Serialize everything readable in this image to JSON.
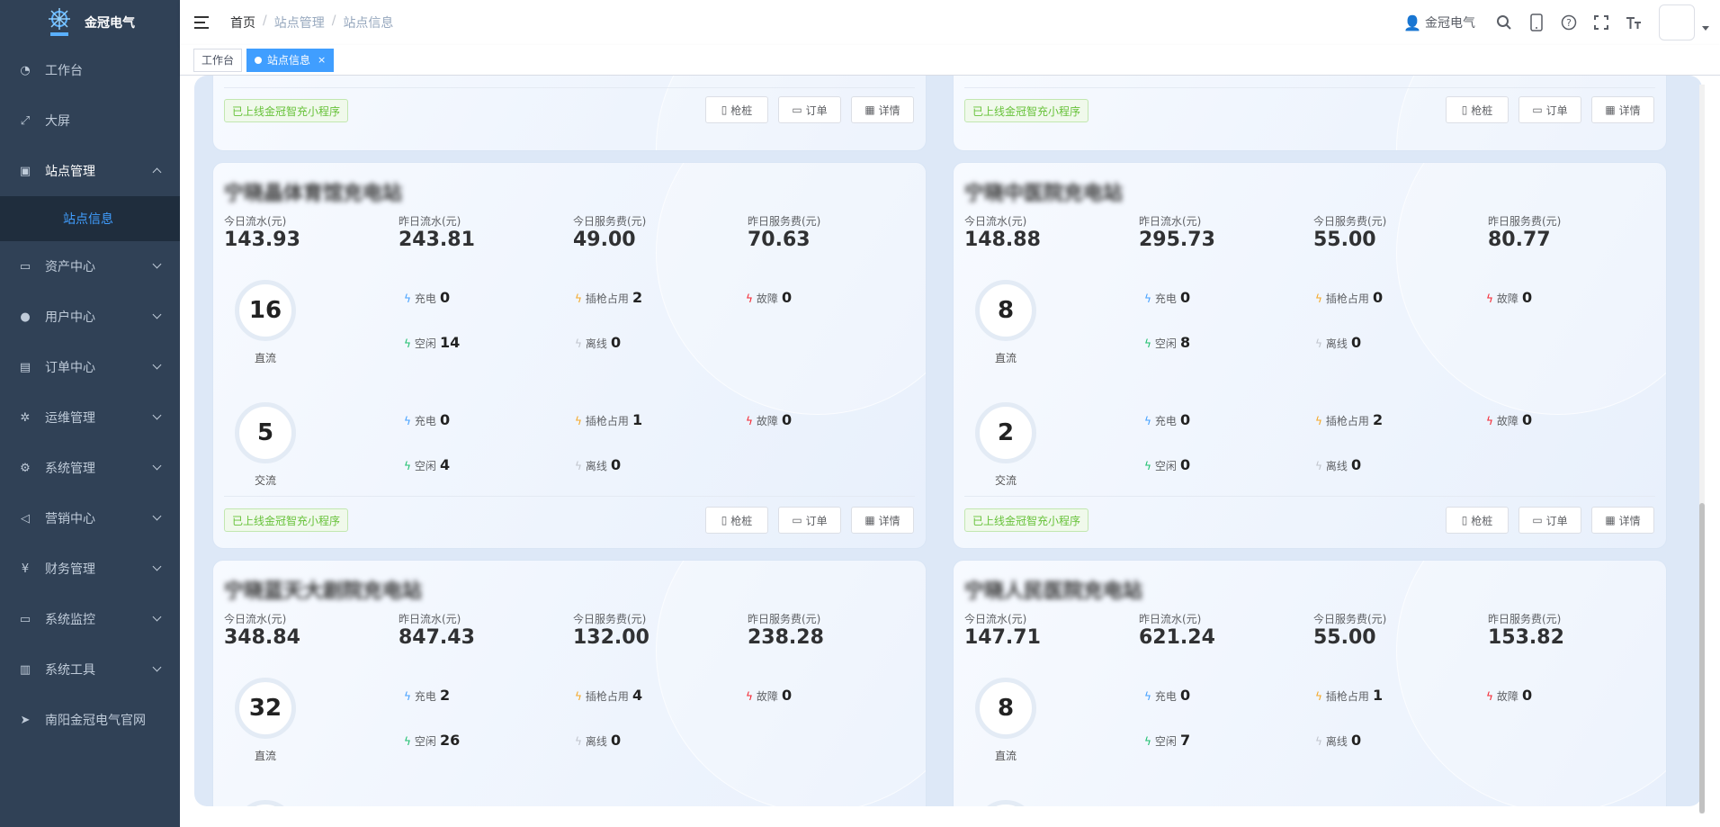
{
  "app": {
    "logo_text": "金冠电气"
  },
  "sidebar": {
    "items": [
      {
        "label": "工作台",
        "icon": "dashboard-icon",
        "expanded": false,
        "has_arrow": false
      },
      {
        "label": "大屏",
        "icon": "fullscreen-icon",
        "expanded": false,
        "has_arrow": false
      },
      {
        "label": "站点管理",
        "icon": "station-icon",
        "expanded": true,
        "has_arrow": true
      },
      {
        "label": "资产中心",
        "icon": "monitor-icon",
        "expanded": false,
        "has_arrow": true
      },
      {
        "label": "用户中心",
        "icon": "user-icon",
        "expanded": false,
        "has_arrow": true
      },
      {
        "label": "订单中心",
        "icon": "order-icon",
        "expanded": false,
        "has_arrow": true
      },
      {
        "label": "运维管理",
        "icon": "tool-icon",
        "expanded": false,
        "has_arrow": true
      },
      {
        "label": "系统管理",
        "icon": "gear-icon",
        "expanded": false,
        "has_arrow": true
      },
      {
        "label": "营销中心",
        "icon": "speaker-icon",
        "expanded": false,
        "has_arrow": true
      },
      {
        "label": "财务管理",
        "icon": "yen-icon",
        "expanded": false,
        "has_arrow": true
      },
      {
        "label": "系统监控",
        "icon": "monitor-chart-icon",
        "expanded": false,
        "has_arrow": true
      },
      {
        "label": "系统工具",
        "icon": "toolbox-icon",
        "expanded": false,
        "has_arrow": true
      },
      {
        "label": "南阳金冠电气官网",
        "icon": "send-icon",
        "expanded": false,
        "has_arrow": false
      }
    ],
    "sub_item": "站点信息"
  },
  "navbar": {
    "breadcrumb": [
      "首页",
      "站点管理",
      "站点信息"
    ],
    "separator": "/",
    "user_name": "金冠电气"
  },
  "tags": {
    "items": [
      "工作台",
      "站点信息"
    ],
    "close": "×"
  },
  "card_common": {
    "labels": {
      "today_flow": "今日流水(元)",
      "yest_flow": "昨日流水(元)",
      "today_service": "今日服务费(元)",
      "yest_service": "昨日服务费(元)",
      "charging": "充电",
      "occupied": "插枪占用",
      "fault": "故障",
      "idle": "空闲",
      "offline": "离线",
      "dc": "直流",
      "ac": "交流"
    },
    "online_text": "已上线金冠智充小程序",
    "btn_pile": "枪桩",
    "btn_order": "订单",
    "btn_detail": "详情"
  },
  "cards": [
    {
      "name": "宁晓晶体育馆充电站",
      "today_flow": "143.93",
      "yest_flow": "243.81",
      "today_service": "49.00",
      "yest_service": "70.63",
      "dc": {
        "total": "16",
        "charging": "0",
        "occupied": "2",
        "fault": "0",
        "idle": "14",
        "offline": "0"
      },
      "ac": {
        "total": "5",
        "charging": "0",
        "occupied": "1",
        "fault": "0",
        "idle": "4",
        "offline": "0"
      }
    },
    {
      "name": "宁晓中医院充电站",
      "today_flow": "148.88",
      "yest_flow": "295.73",
      "today_service": "55.00",
      "yest_service": "80.77",
      "dc": {
        "total": "8",
        "charging": "0",
        "occupied": "0",
        "fault": "0",
        "idle": "8",
        "offline": "0"
      },
      "ac": {
        "total": "2",
        "charging": "0",
        "occupied": "2",
        "fault": "0",
        "idle": "0",
        "offline": "0"
      }
    },
    {
      "name": "宁晓蓝天大剧院充电站",
      "today_flow": "348.84",
      "yest_flow": "847.43",
      "today_service": "132.00",
      "yest_service": "238.28",
      "dc": {
        "total": "32",
        "charging": "2",
        "occupied": "4",
        "fault": "0",
        "idle": "26",
        "offline": "0"
      }
    },
    {
      "name": "宁晓人民医院充电站",
      "today_flow": "147.71",
      "yest_flow": "621.24",
      "today_service": "55.00",
      "yest_service": "153.82",
      "dc": {
        "total": "8",
        "charging": "0",
        "occupied": "1",
        "fault": "0",
        "idle": "7",
        "offline": "0"
      }
    }
  ],
  "colors": {
    "sidebar_bg": "#304156",
    "accent": "#409eff",
    "online_green": "#67c23a",
    "bolt_blue": "#409eff",
    "bolt_orange": "#f5a623",
    "bolt_red": "#f5222d",
    "bolt_green": "#19be6b",
    "bolt_gray": "#c0c4cc"
  }
}
